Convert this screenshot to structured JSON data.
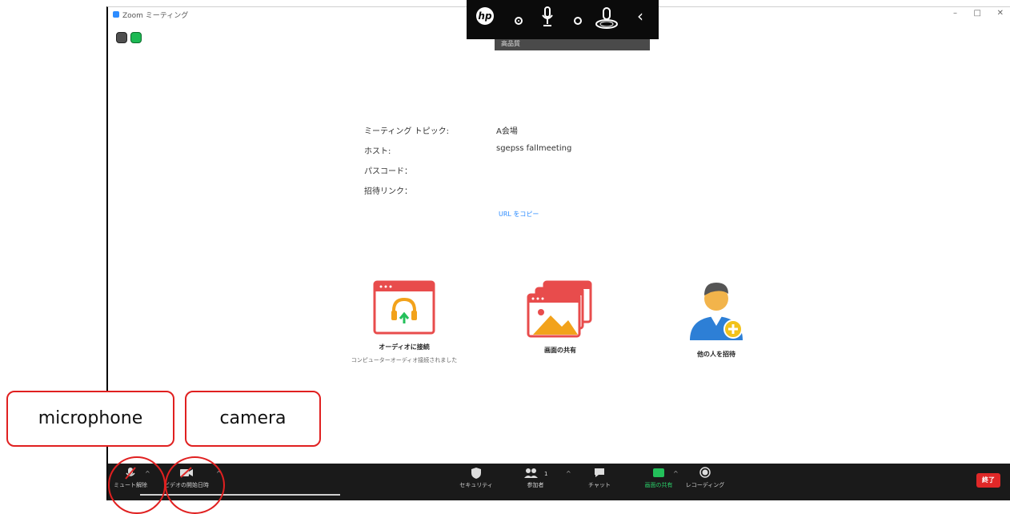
{
  "window": {
    "title": "Zoom ミーティング",
    "controls": {
      "minimize": "–",
      "maximize": "□",
      "close": "✕"
    }
  },
  "hp_overlay": {
    "logo": "hp",
    "tooltip": "高品質"
  },
  "meeting_info": {
    "rows": [
      {
        "label": "ミーティング トピック:",
        "value": "A会場"
      },
      {
        "label": "ホスト:",
        "value": "sgepss fallmeeting"
      },
      {
        "label": "パスコード：",
        "value": ""
      },
      {
        "label": "招待リンク：",
        "value": ""
      }
    ],
    "copy_url": "URL をコピー"
  },
  "tiles": {
    "audio": {
      "label": "オーディオに接続",
      "sub": "コンピューターオーディオ接続されました"
    },
    "share": {
      "label": "画面の共有"
    },
    "invite": {
      "label": "他の人を招待"
    }
  },
  "toolbar": {
    "mute": "ミュート解除",
    "video": "ビデオの開始日時",
    "security": "セキュリティ",
    "participants": "参加者",
    "participants_count": "1",
    "chat": "チャット",
    "share": "画面の共有",
    "record": "レコーディング",
    "end": "終了"
  },
  "annotations": {
    "microphone": "microphone",
    "camera": "camera"
  },
  "colors": {
    "accent": "#2d8cff",
    "annotation": "#e02020",
    "end": "#e02828",
    "share_green": "#23c05a",
    "toolbar_bg": "#1a1a1a"
  }
}
